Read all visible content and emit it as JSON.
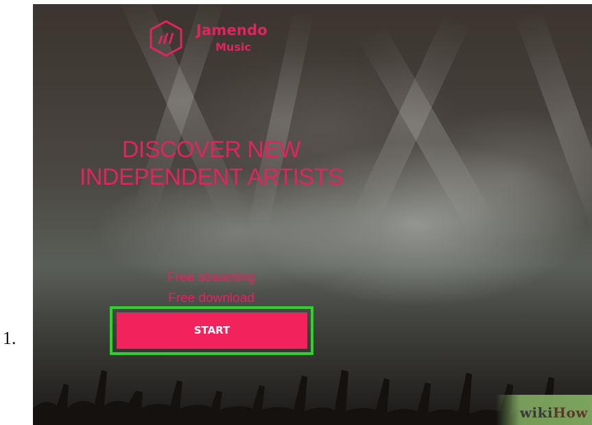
{
  "step": {
    "number": "1."
  },
  "app": {
    "brand_name": "Jamendo",
    "brand_sub": "Music",
    "brand_color": "#e0245e"
  },
  "hero": {
    "headline_line1": "DISCOVER NEW",
    "headline_line2": "INDEPENDENT ARTISTS",
    "feature_1": "Free streaming",
    "feature_2": "Free download",
    "start_label": "START",
    "start_color": "#f2225c",
    "highlight_color": "#29d627"
  },
  "watermark": {
    "part1": "wiki",
    "part2": "How"
  }
}
